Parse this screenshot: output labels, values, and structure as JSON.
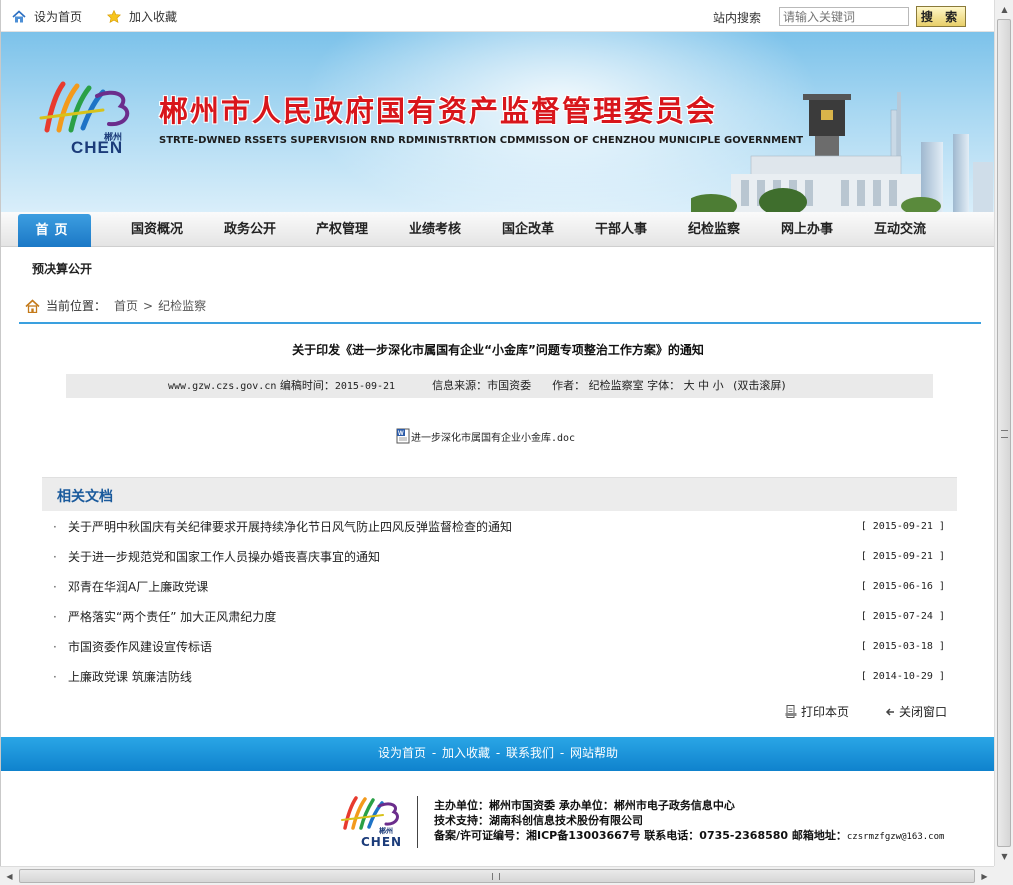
{
  "topbar": {
    "set_home": "设为首页",
    "add_favorite": "加入收藏",
    "search_label": "站内搜索",
    "search_placeholder": "请输入关键词",
    "search_button": "搜 索"
  },
  "banner": {
    "title_cn": "郴州市人民政府国有资产监督管理委员会",
    "title_en": "STRTE-DWNED RSSETS SUPERVISION RND RDMINISTRRTION CDMMISSON OF CHENZHOU MUNICIPLE GOVERNMENT",
    "logo_text": "CHEN",
    "logo_cn": "郴州"
  },
  "nav": {
    "items": [
      "首页",
      "国资概况",
      "政务公开",
      "产权管理",
      "业绩考核",
      "国企改革",
      "干部人事",
      "纪检监察",
      "网上办事",
      "互动交流"
    ],
    "sub_item": "预决算公开"
  },
  "breadcrumb": {
    "label": "当前位置：",
    "home": "首页",
    "separator": ">",
    "current": "纪检监察"
  },
  "article": {
    "title": "关于印发《进一步深化市属国有企业“小金库”问题专项整治工作方案》的通知",
    "site": "www.gzw.czs.gov.cn",
    "edit_time_label": "编稿时间：",
    "edit_time": "2015-09-21",
    "source_label": "信息来源：",
    "source": "市国资委",
    "author_label": "作者：",
    "author": "纪检监察室",
    "font_label": "字体：",
    "font_large": "大",
    "font_medium": "中",
    "font_small": "小",
    "scroll_hint": "(双击滚屏)",
    "attachment": "进一步深化市属国有企业小金库.doc"
  },
  "related": {
    "heading": "相关文档",
    "items": [
      {
        "title": "关于严明中秋国庆有关纪律要求开展持续净化节日风气防止四风反弹监督检查的通知",
        "date": "[ 2015-09-21 ]"
      },
      {
        "title": "关于进一步规范党和国家工作人员操办婚丧喜庆事宜的通知",
        "date": "[ 2015-09-21 ]"
      },
      {
        "title": "邓青在华润A厂上廉政党课",
        "date": "[ 2015-06-16 ]"
      },
      {
        "title": "严格落实“两个责任” 加大正风肃纪力度",
        "date": "[ 2015-07-24 ]"
      },
      {
        "title": "市国资委作风建设宣传标语",
        "date": "[ 2015-03-18 ]"
      },
      {
        "title": "上廉政党课 筑廉洁防线",
        "date": "[ 2014-10-29 ]"
      }
    ]
  },
  "actions": {
    "print": "打印本页",
    "close": "关闭窗口"
  },
  "footer": {
    "links": [
      "设为首页",
      "加入收藏",
      "联系我们",
      "网站帮助"
    ],
    "link_sep": "-",
    "line1": "主办单位：郴州市国资委  承办单位：郴州市电子政务信息中心",
    "line2": "技术支持：湖南科创信息技术股份有限公司",
    "line3_prefix": "备案/许可证编号：湘ICP备13003667号 联系电话：0735-2368580 邮箱地址：",
    "email": "czsrmzfgzw@163.com",
    "logo_text": "CHEN",
    "logo_cn": "郴州"
  },
  "colors": {
    "nav_active": "#1b78c6",
    "banner_title": "#d8161b",
    "footer_bar": "#0f82cd",
    "rule": "#3aa0df"
  }
}
